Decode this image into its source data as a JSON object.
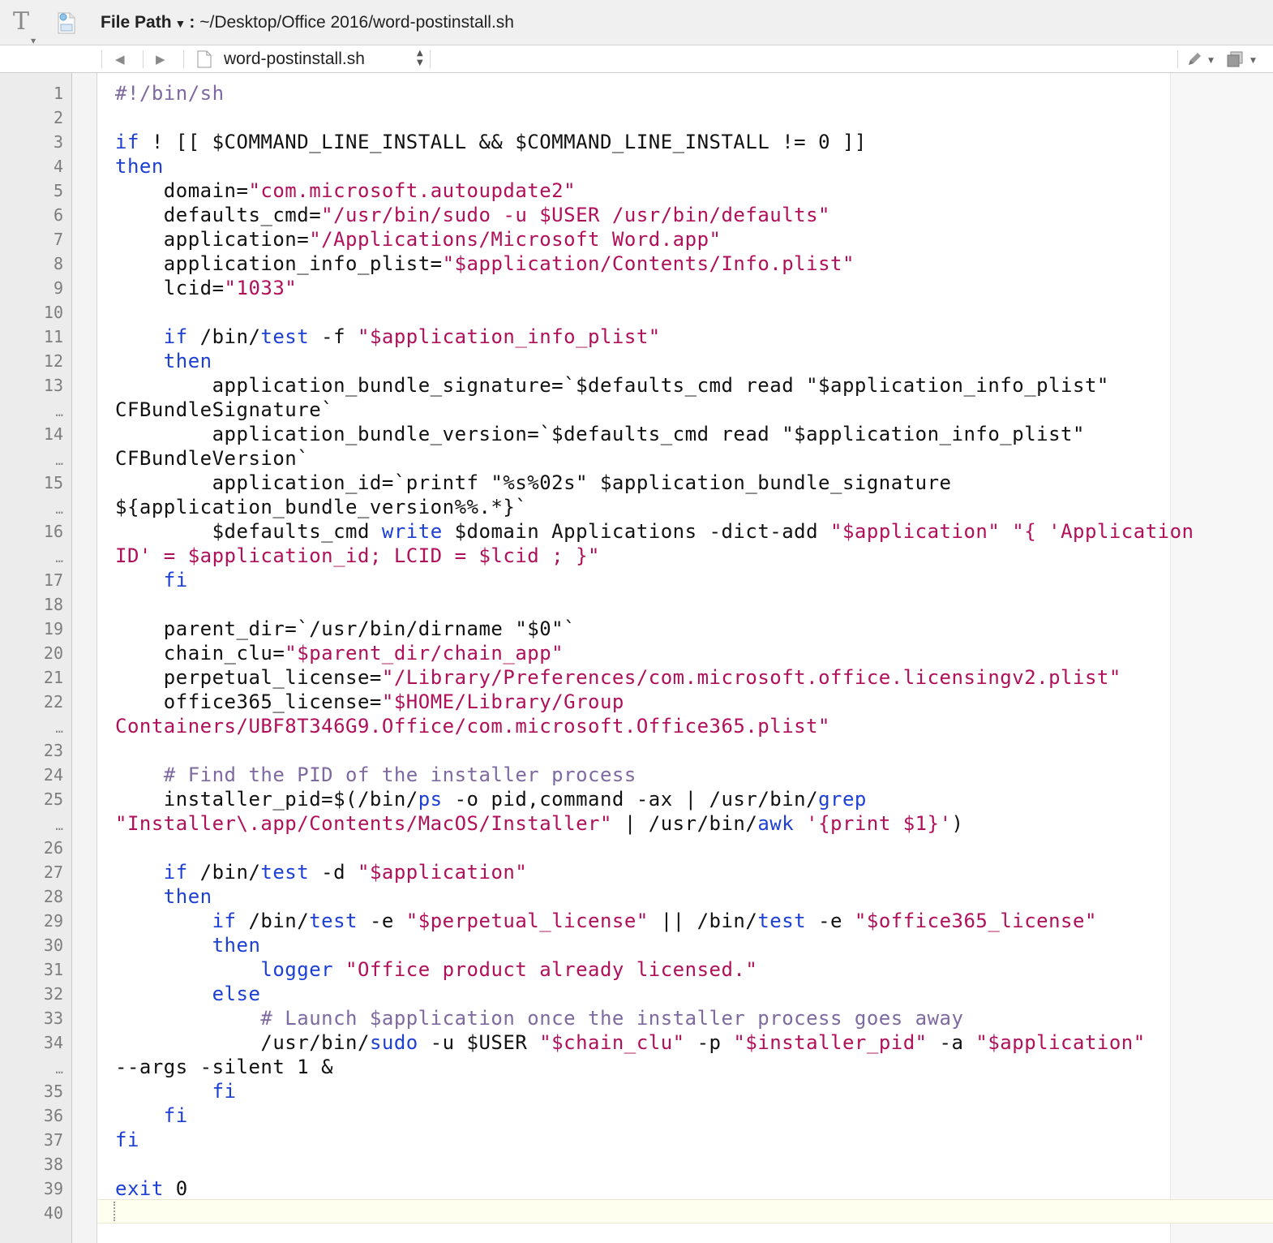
{
  "path_bar": {
    "label": "File Path",
    "separator": ":",
    "path": "~/Desktop/Office 2016/word-postinstall.sh"
  },
  "nav_bar": {
    "file_name": "word-postinstall.sh"
  },
  "colors": {
    "keyword": "#1c3fd6",
    "string": "#b0105a",
    "comment": "#7e6aa0",
    "text": "#111111"
  },
  "editor": {
    "line_numbers": [
      "1",
      "2",
      "3",
      "4",
      "5",
      "6",
      "7",
      "8",
      "9",
      "10",
      "11",
      "12",
      "13",
      "…",
      "14",
      "…",
      "15",
      "…",
      "16",
      "…",
      "17",
      "18",
      "19",
      "20",
      "21",
      "22",
      "…",
      "23",
      "24",
      "25",
      "…",
      "26",
      "27",
      "28",
      "29",
      "30",
      "31",
      "32",
      "33",
      "34",
      "…",
      "35",
      "36",
      "37",
      "38",
      "39",
      "40"
    ],
    "lines": [
      [
        [
          "cmt",
          "#!/bin/sh"
        ]
      ],
      [],
      [
        [
          "kw",
          "if"
        ],
        [
          "t",
          " ! [[ $COMMAND_LINE_INSTALL && $COMMAND_LINE_INSTALL != 0 ]]"
        ]
      ],
      [
        [
          "kw",
          "then"
        ]
      ],
      [
        [
          "t",
          "    domain="
        ],
        [
          "str",
          "\"com.microsoft.autoupdate2\""
        ]
      ],
      [
        [
          "t",
          "    defaults_cmd="
        ],
        [
          "str",
          "\"/usr/bin/sudo -u $USER /usr/bin/defaults\""
        ]
      ],
      [
        [
          "t",
          "    application="
        ],
        [
          "str",
          "\"/Applications/Microsoft Word.app\""
        ]
      ],
      [
        [
          "t",
          "    application_info_plist="
        ],
        [
          "str",
          "\"$application/Contents/Info.plist\""
        ]
      ],
      [
        [
          "t",
          "    lcid="
        ],
        [
          "str",
          "\"1033\""
        ]
      ],
      [],
      [
        [
          "kw",
          "    if"
        ],
        [
          "t",
          " /bin/"
        ],
        [
          "kw",
          "test"
        ],
        [
          "t",
          " -f "
        ],
        [
          "str",
          "\"$application_info_plist\""
        ]
      ],
      [
        [
          "kw",
          "    then"
        ]
      ],
      [
        [
          "t",
          "        application_bundle_signature=`$defaults_cmd read \"$application_info_plist\""
        ]
      ],
      [
        [
          "t",
          "CFBundleSignature`"
        ]
      ],
      [
        [
          "t",
          "        application_bundle_version=`$defaults_cmd read \"$application_info_plist\""
        ]
      ],
      [
        [
          "t",
          "CFBundleVersion`"
        ]
      ],
      [
        [
          "t",
          "        application_id=`printf \"%s%02s\" $application_bundle_signature"
        ]
      ],
      [
        [
          "t",
          "${application_bundle_version%%.*}`"
        ]
      ],
      [
        [
          "t",
          "        $defaults_cmd "
        ],
        [
          "kw",
          "write"
        ],
        [
          "t",
          " $domain Applications -dict-add "
        ],
        [
          "str",
          "\"$application\""
        ],
        [
          "t",
          " "
        ],
        [
          "str",
          "\"{ 'Application"
        ]
      ],
      [
        [
          "str",
          "ID' = $application_id; LCID = $lcid ; }\""
        ]
      ],
      [
        [
          "kw",
          "    fi"
        ]
      ],
      [],
      [
        [
          "t",
          "    parent_dir=`/usr/bin/dirname \"$0\"`"
        ]
      ],
      [
        [
          "t",
          "    chain_clu="
        ],
        [
          "str",
          "\"$parent_dir/chain_app\""
        ]
      ],
      [
        [
          "t",
          "    perpetual_license="
        ],
        [
          "str",
          "\"/Library/Preferences/com.microsoft.office.licensingv2.plist\""
        ]
      ],
      [
        [
          "t",
          "    office365_license="
        ],
        [
          "str",
          "\"$HOME/Library/Group"
        ]
      ],
      [
        [
          "str",
          "Containers/UBF8T346G9.Office/com.microsoft.Office365.plist\""
        ]
      ],
      [],
      [
        [
          "cmt",
          "    # Find the PID of the installer process"
        ]
      ],
      [
        [
          "t",
          "    installer_pid=$(/bin/"
        ],
        [
          "kw",
          "ps"
        ],
        [
          "t",
          " -o pid,command -ax | /usr/bin/"
        ],
        [
          "kw",
          "grep"
        ]
      ],
      [
        [
          "str",
          "\"Installer\\.app/Contents/MacOS/Installer\""
        ],
        [
          "t",
          " | /usr/bin/"
        ],
        [
          "kw",
          "awk"
        ],
        [
          "t",
          " "
        ],
        [
          "str",
          "'{print $1}'"
        ],
        [
          "t",
          ")"
        ]
      ],
      [],
      [
        [
          "kw",
          "    if"
        ],
        [
          "t",
          " /bin/"
        ],
        [
          "kw",
          "test"
        ],
        [
          "t",
          " -d "
        ],
        [
          "str",
          "\"$application\""
        ]
      ],
      [
        [
          "kw",
          "    then"
        ]
      ],
      [
        [
          "kw",
          "        if"
        ],
        [
          "t",
          " /bin/"
        ],
        [
          "kw",
          "test"
        ],
        [
          "t",
          " -e "
        ],
        [
          "str",
          "\"$perpetual_license\""
        ],
        [
          "t",
          " || /bin/"
        ],
        [
          "kw",
          "test"
        ],
        [
          "t",
          " -e "
        ],
        [
          "str",
          "\"$office365_license\""
        ]
      ],
      [
        [
          "kw",
          "        then"
        ]
      ],
      [
        [
          "kw",
          "            logger"
        ],
        [
          "t",
          " "
        ],
        [
          "str",
          "\"Office product already licensed.\""
        ]
      ],
      [
        [
          "kw",
          "        else"
        ]
      ],
      [
        [
          "cmt",
          "            # Launch $application once the installer process goes away"
        ]
      ],
      [
        [
          "t",
          "            /usr/bin/"
        ],
        [
          "kw",
          "sudo"
        ],
        [
          "t",
          " -u $USER "
        ],
        [
          "str",
          "\"$chain_clu\""
        ],
        [
          "t",
          " -p "
        ],
        [
          "str",
          "\"$installer_pid\""
        ],
        [
          "t",
          " -a "
        ],
        [
          "str",
          "\"$application\""
        ]
      ],
      [
        [
          "t",
          "--args -silent 1 &"
        ]
      ],
      [
        [
          "kw",
          "        fi"
        ]
      ],
      [
        [
          "kw",
          "    fi"
        ]
      ],
      [
        [
          "kw",
          "fi"
        ]
      ],
      [],
      [
        [
          "kw",
          "exit"
        ],
        [
          "t",
          " 0"
        ]
      ],
      []
    ]
  }
}
